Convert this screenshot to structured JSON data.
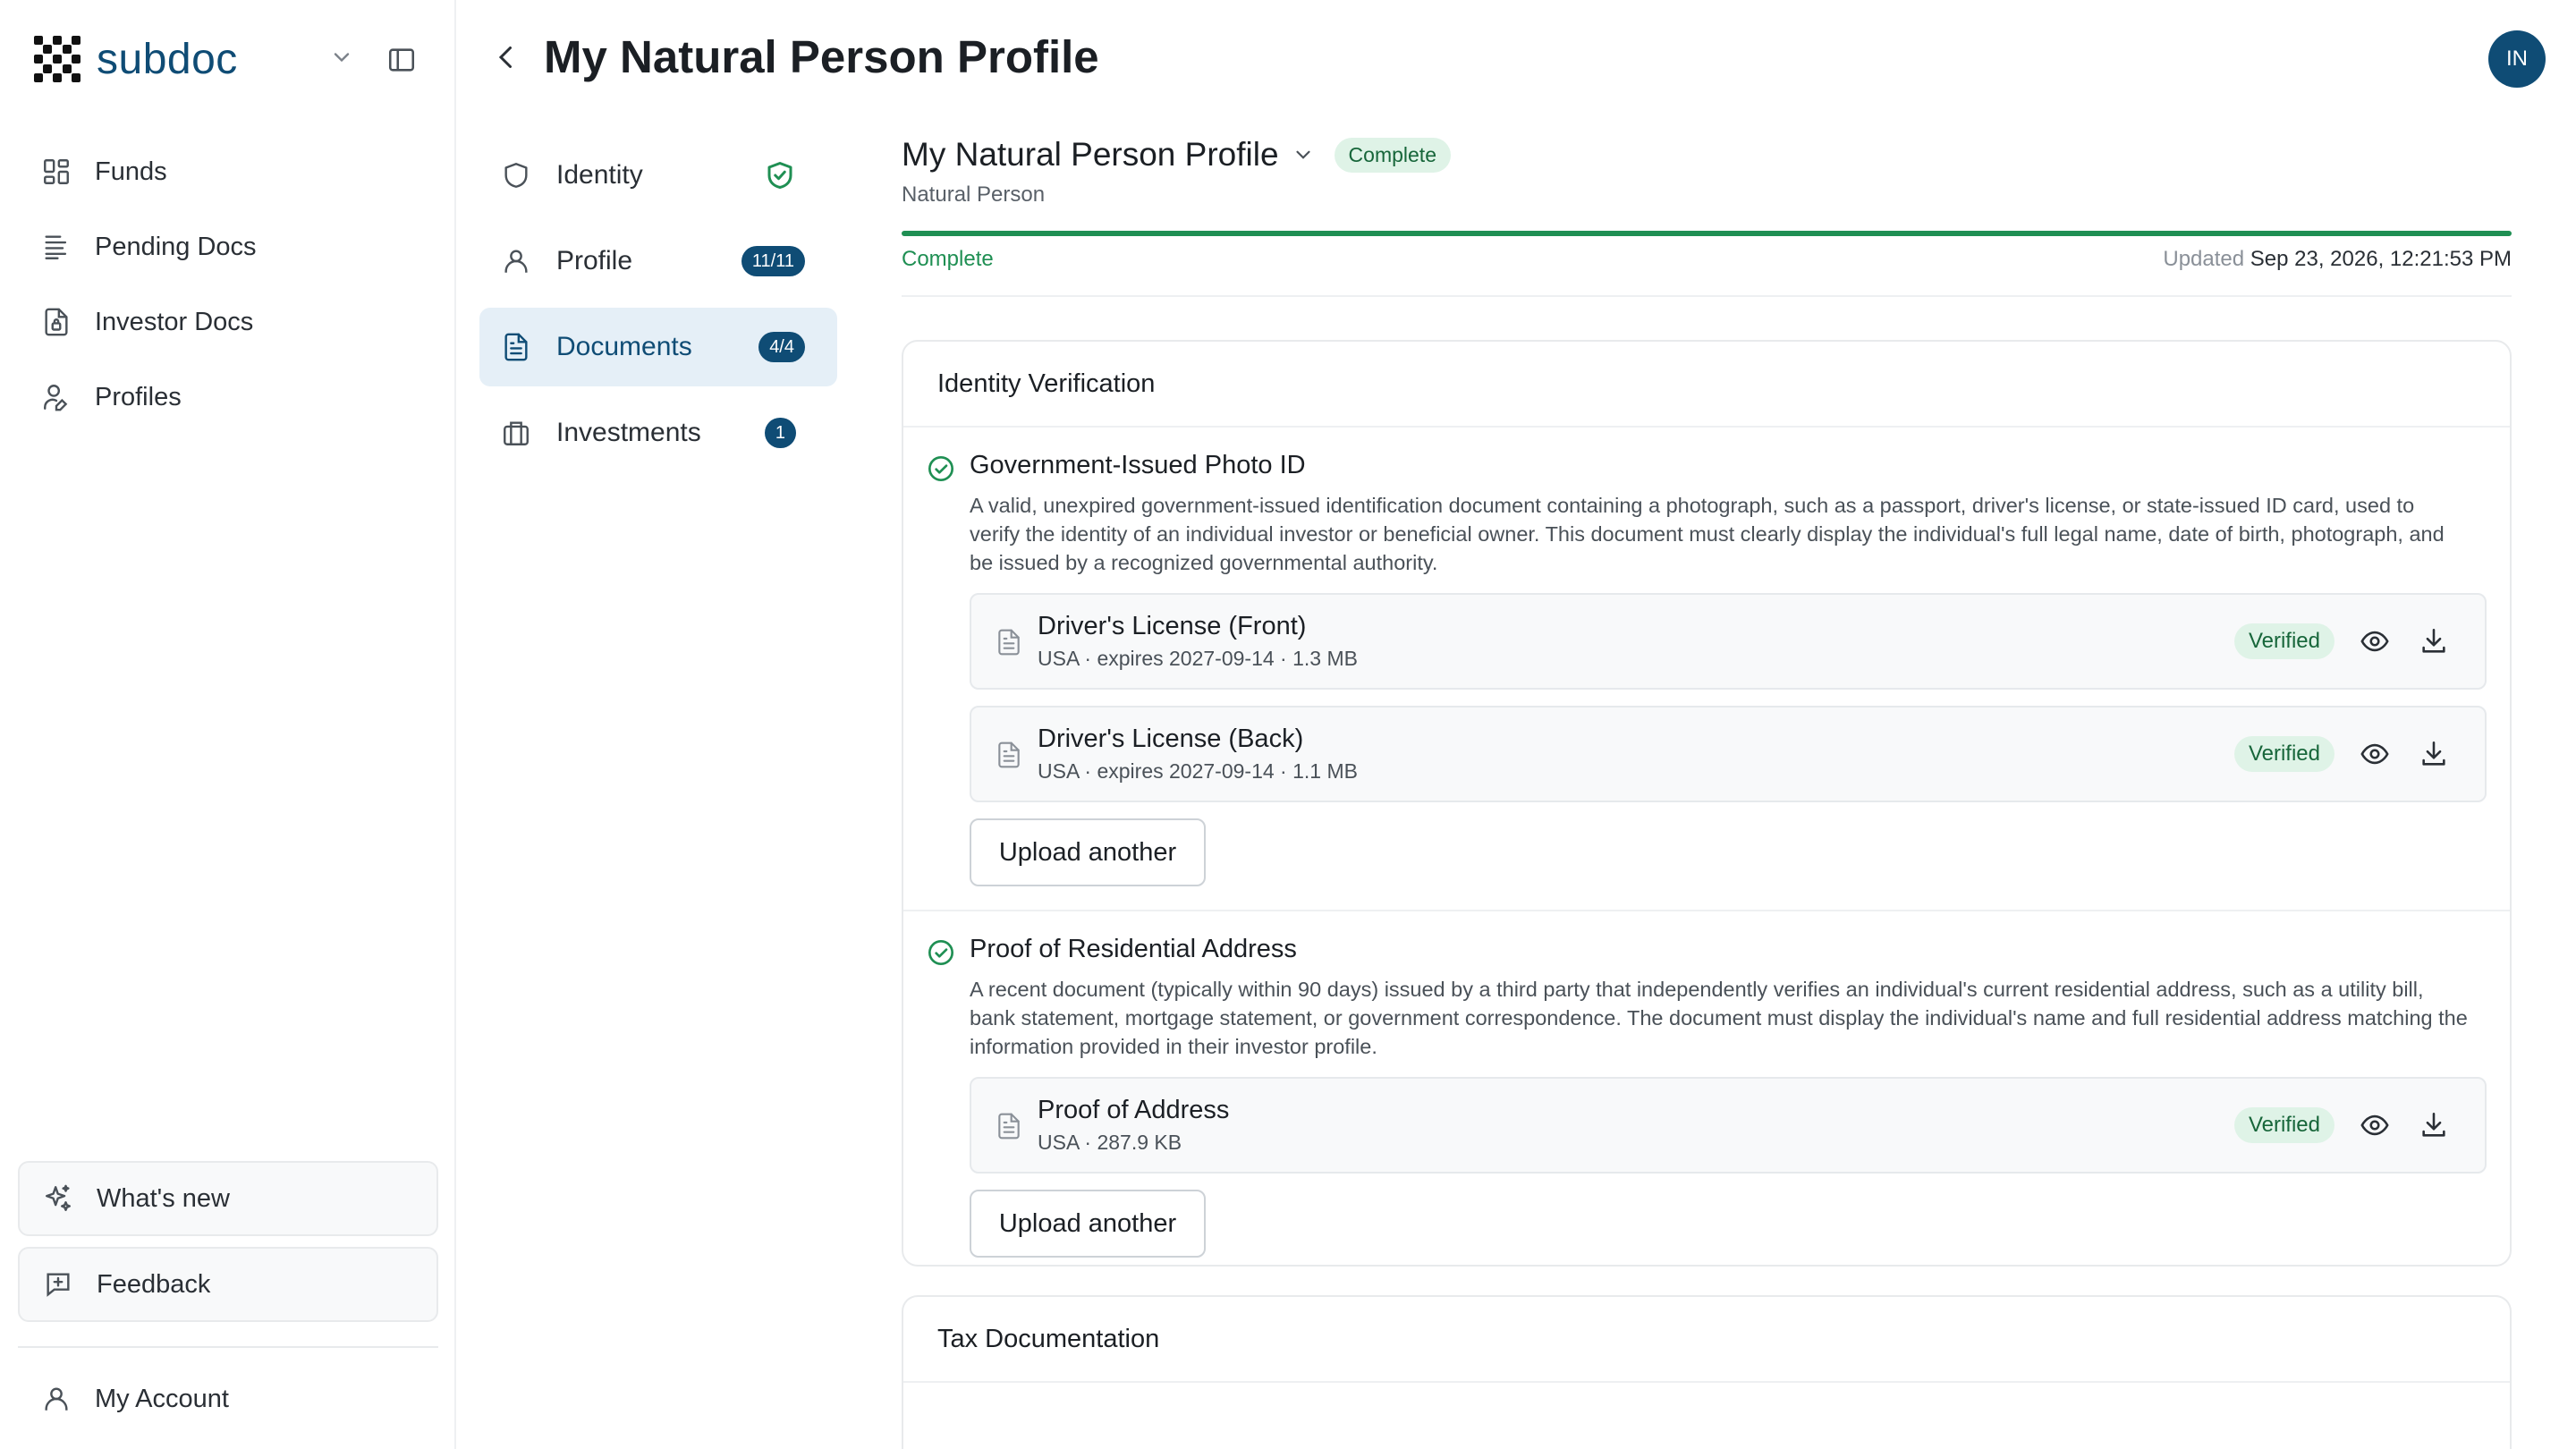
{
  "brand": {
    "name": "subdoc"
  },
  "sidebar": {
    "items": [
      {
        "label": "Funds",
        "icon": "grid-icon"
      },
      {
        "label": "Pending Docs",
        "icon": "list-icon"
      },
      {
        "label": "Investor Docs",
        "icon": "file-lock-icon"
      },
      {
        "label": "Profiles",
        "icon": "user-edit-icon"
      }
    ],
    "whats_new": "What's new",
    "feedback": "Feedback",
    "account": "My Account"
  },
  "header": {
    "title": "My Natural Person Profile",
    "avatar_initials": "IN"
  },
  "subnav": {
    "items": [
      {
        "label": "Identity",
        "badge": ""
      },
      {
        "label": "Profile",
        "badge": "11/11"
      },
      {
        "label": "Documents",
        "badge": "4/4"
      },
      {
        "label": "Investments",
        "badge": "1"
      }
    ]
  },
  "profile": {
    "name": "My Natural Person Profile",
    "status": "Complete",
    "type": "Natural Person",
    "progress_percent": 100,
    "progress_label": "Complete",
    "updated_label": "Updated",
    "updated_value": "Sep 23, 2026, 12:21:53 PM"
  },
  "identity_card": {
    "title": "Identity Verification",
    "sections": [
      {
        "title": "Government-Issued Photo ID",
        "description": "A valid, unexpired government-issued identification document containing a photograph, such as a passport, driver's license, or state-issued ID card, used to verify the identity of an individual investor or beneficial owner. This document must clearly display the individual's full legal name, date of birth, photograph, and be issued by a recognized governmental authority.",
        "documents": [
          {
            "name": "Driver's License (Front)",
            "meta": "USA · expires 2027-09-14 · 1.3 MB",
            "status": "Verified"
          },
          {
            "name": "Driver's License (Back)",
            "meta": "USA · expires 2027-09-14 · 1.1 MB",
            "status": "Verified"
          }
        ],
        "upload_label": "Upload another"
      },
      {
        "title": "Proof of Residential Address",
        "description": "A recent document (typically within 90 days) issued by a third party that independently verifies an individual's current residential address, such as a utility bill, bank statement, mortgage statement, or government correspondence. The document must display the individual's name and full residential address matching the information provided in their investor profile.",
        "documents": [
          {
            "name": "Proof of Address",
            "meta": "USA · 287.9 KB",
            "status": "Verified"
          }
        ],
        "upload_label": "Upload another"
      }
    ]
  },
  "tax_card": {
    "title": "Tax Documentation"
  },
  "colors": {
    "brand": "#0f4c75",
    "success": "#1f8f53",
    "success_bg": "#dff3e7"
  }
}
